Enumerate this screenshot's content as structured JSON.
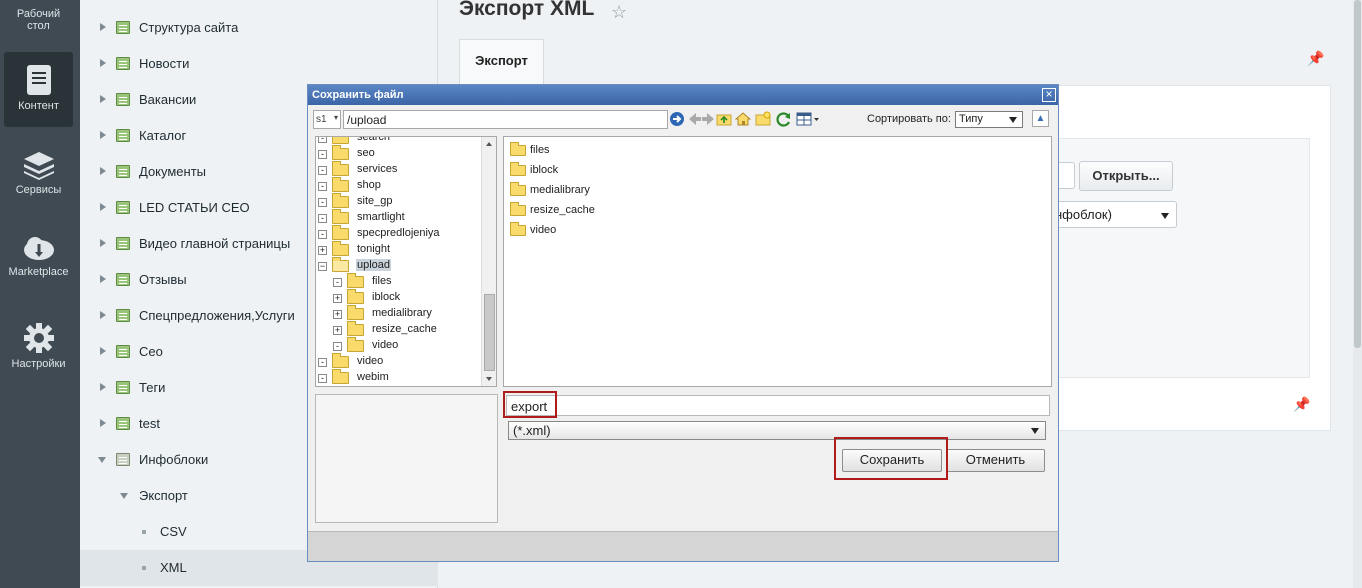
{
  "rail": {
    "items": [
      {
        "label": "Рабочий стол",
        "icon": "desktop-icon"
      },
      {
        "label": "Контент",
        "icon": "content-icon"
      },
      {
        "label": "Сервисы",
        "icon": "services-icon"
      },
      {
        "label": "Marketplace",
        "icon": "marketplace-icon"
      },
      {
        "label": "Настройки",
        "icon": "settings-icon"
      }
    ]
  },
  "menu": {
    "items": [
      {
        "label": "Структура сайта"
      },
      {
        "label": "Новости"
      },
      {
        "label": "Вакансии"
      },
      {
        "label": "Каталог"
      },
      {
        "label": "Документы"
      },
      {
        "label": "LED СТАТЬИ СЕО"
      },
      {
        "label": "Видео главной страницы"
      },
      {
        "label": "Отзывы"
      },
      {
        "label": "Спецпредложения,Услуги"
      },
      {
        "label": "Сео"
      },
      {
        "label": "Теги"
      },
      {
        "label": "test"
      },
      {
        "label": "Инфоблоки"
      },
      {
        "label": "Экспорт"
      },
      {
        "label": "CSV"
      },
      {
        "label": "XML"
      }
    ]
  },
  "page": {
    "title": "Экспорт XML",
    "tab": "Экспорт",
    "open_button": "Открыть...",
    "select_partial": "нфоблок)"
  },
  "dialog": {
    "title": "Сохранить файл",
    "site": "s1",
    "path": "/upload",
    "sort_label": "Сортировать по:",
    "sort_value": "Типу",
    "tree": [
      {
        "name": "search",
        "sign": "-"
      },
      {
        "name": "seo",
        "sign": "-"
      },
      {
        "name": "services",
        "sign": "-"
      },
      {
        "name": "shop",
        "sign": "-"
      },
      {
        "name": "site_gp",
        "sign": "-"
      },
      {
        "name": "smartlight",
        "sign": "-"
      },
      {
        "name": "specpredlojeniya",
        "sign": "-"
      },
      {
        "name": "tonight",
        "sign": "+"
      },
      {
        "name": "upload",
        "sign": "−"
      },
      {
        "name": "files",
        "sign": "-"
      },
      {
        "name": "iblock",
        "sign": "+"
      },
      {
        "name": "medialibrary",
        "sign": "+"
      },
      {
        "name": "resize_cache",
        "sign": "+"
      },
      {
        "name": "video",
        "sign": "-"
      },
      {
        "name": "video",
        "sign": "-"
      },
      {
        "name": "webim",
        "sign": "-"
      }
    ],
    "files": [
      "files",
      "iblock",
      "medialibrary",
      "resize_cache",
      "video"
    ],
    "filename": "export",
    "filetype": "(*.xml)",
    "save_label": "Сохранить",
    "cancel_label": "Отменить"
  },
  "colors": {
    "rail_bg": "#3f4a52",
    "dialog_title": "#3b65a6",
    "highlight": "#b01c1c"
  }
}
